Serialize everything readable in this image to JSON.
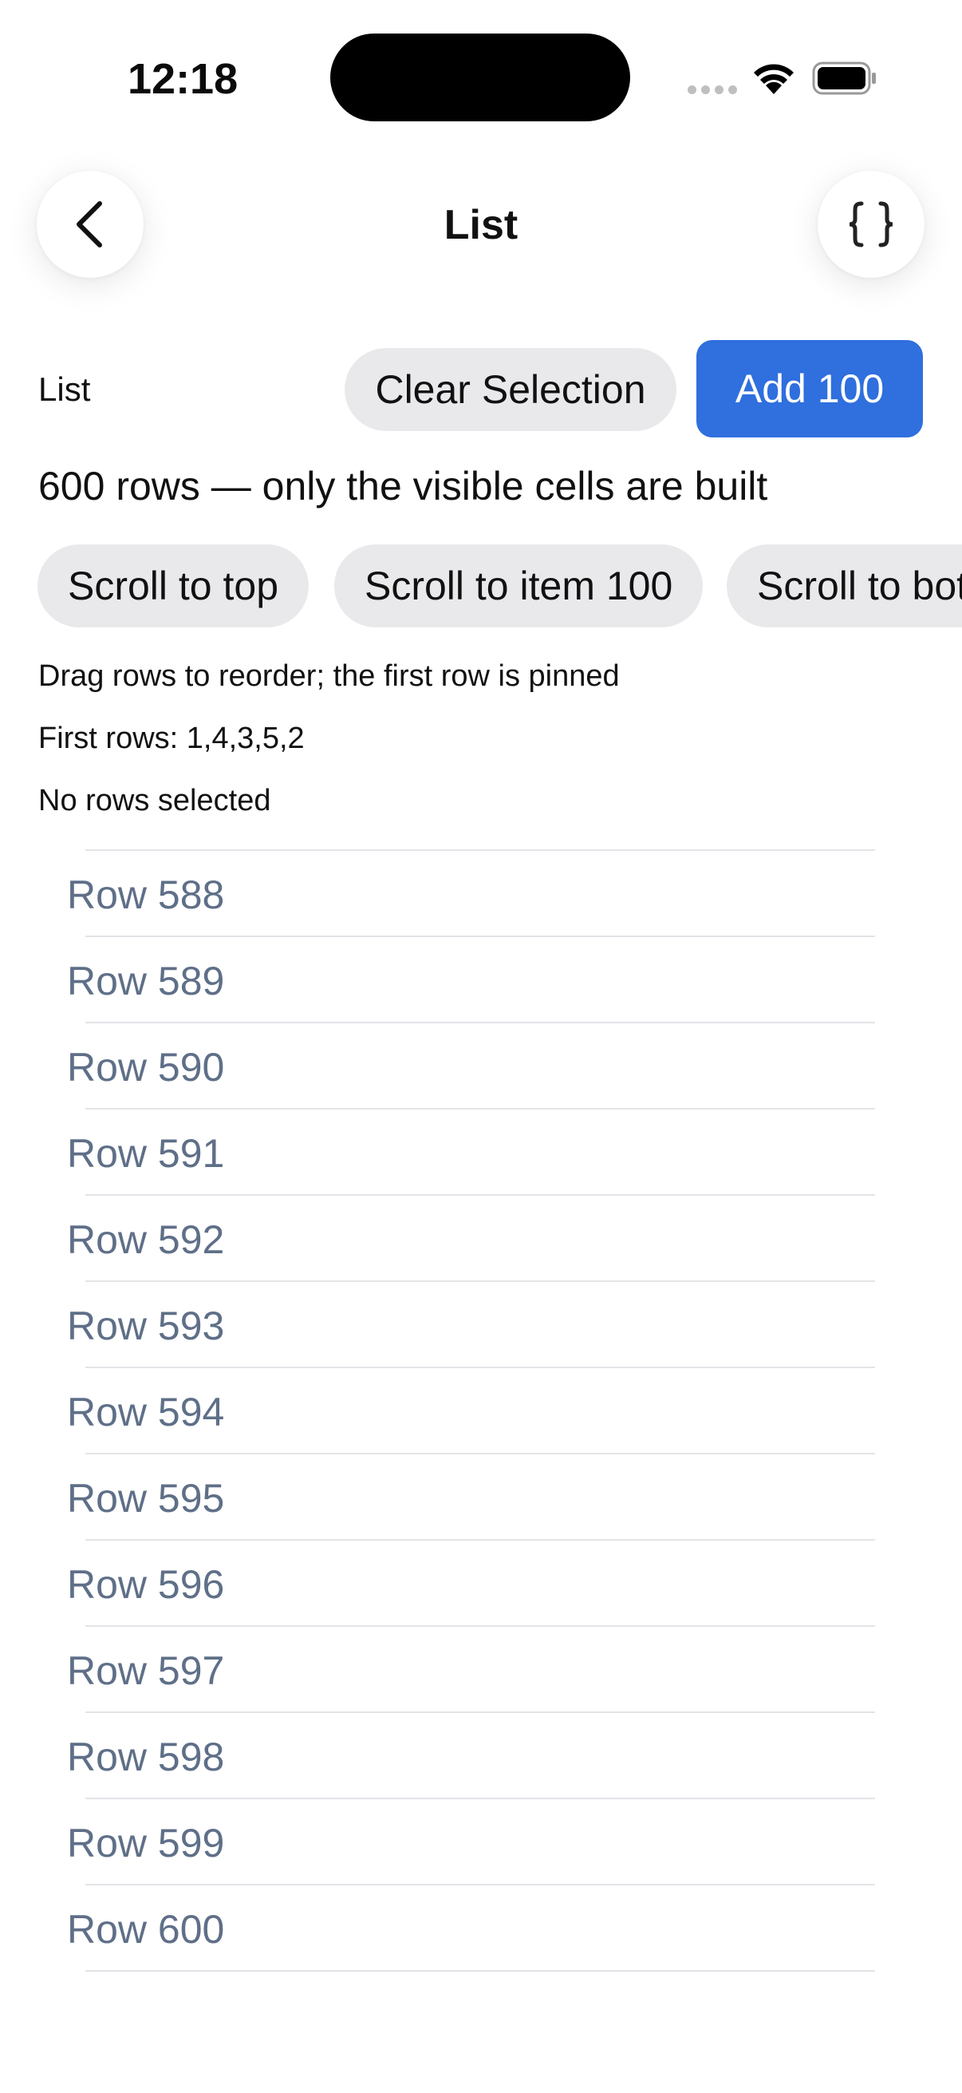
{
  "status_bar": {
    "time": "12:18"
  },
  "nav": {
    "back_icon": "chevron-left-icon",
    "title": "List",
    "code_icon": "curly-braces-icon"
  },
  "toolbar": {
    "label": "List",
    "clear_label": "Clear Selection",
    "add_label": "Add 100",
    "accent_color": "#2f6fde"
  },
  "summary": "600 rows — only the visible cells are built",
  "scroll_buttons": [
    "Scroll to top",
    "Scroll to item 100",
    "Scroll to bottom"
  ],
  "info": {
    "drag_hint": "Drag rows to reorder; the first row is pinned",
    "first_rows": "First rows: 1,4,3,5,2",
    "selection": "No rows selected"
  },
  "rows": [
    "Row 588",
    "Row 589",
    "Row 590",
    "Row 591",
    "Row 592",
    "Row 593",
    "Row 594",
    "Row 595",
    "Row 596",
    "Row 597",
    "Row 598",
    "Row 599",
    "Row 600"
  ]
}
